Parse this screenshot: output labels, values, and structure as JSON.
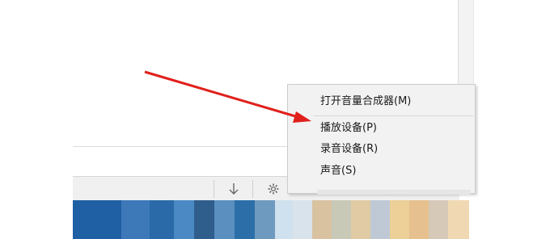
{
  "context_menu": {
    "items": [
      {
        "label": "打开音量合成器(M)"
      },
      {
        "label": "播放设备(P)"
      },
      {
        "label": "录音设备(R)"
      },
      {
        "label": "声音(S)"
      }
    ]
  },
  "toolbar": {
    "icons": [
      "down-arrow-icon",
      "gear-icon"
    ]
  },
  "colors": {
    "annotation_arrow": "#e0201b",
    "menu_background": "#f2f2f2",
    "taskbar_blue": "#1f5fa3"
  }
}
